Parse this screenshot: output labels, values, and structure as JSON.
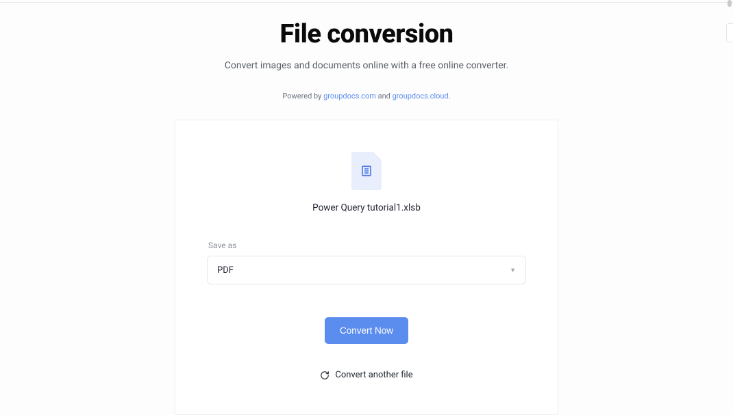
{
  "header": {
    "title": "File conversion",
    "subtitle": "Convert images and documents online with a free online converter.",
    "powered_prefix": "Powered by ",
    "powered_link1": "groupdocs.com",
    "powered_and": " and ",
    "powered_link2": "groupdocs.cloud",
    "powered_suffix": "."
  },
  "file": {
    "name": "Power Query tutorial1.xlsb"
  },
  "save_as": {
    "label": "Save as",
    "selected": "PDF"
  },
  "actions": {
    "convert_now": "Convert Now",
    "convert_another": "Convert another file"
  }
}
